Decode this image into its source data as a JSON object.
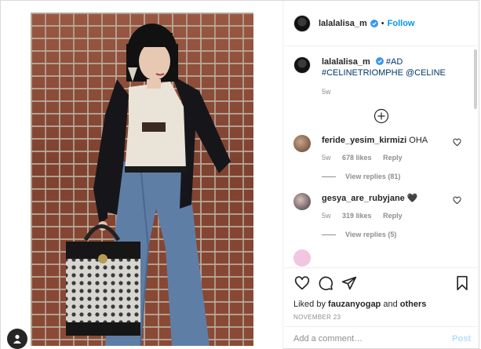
{
  "header": {
    "username": "lalalalisa_m",
    "separator": "•",
    "follow_label": "Follow"
  },
  "caption": {
    "username": "lalalalisa_m",
    "hashtag_line1": "#AD",
    "hashtag_line2": "#CELINETRIOMPHE",
    "mention": "@CELINE",
    "age": "5w"
  },
  "comments": [
    {
      "username": "feride_yesim_kirmizi",
      "text": "OHA",
      "age": "5w",
      "likes": "678 likes",
      "reply_label": "Reply",
      "view_replies": "View replies (81)",
      "avatar_color": "#7a5a4a"
    },
    {
      "username": "gesya_are_rubyjane",
      "text": "🖤",
      "age": "5w",
      "likes": "319 likes",
      "reply_label": "Reply",
      "view_replies": "View replies (5)",
      "avatar_color": "#6b6870"
    }
  ],
  "actions": {
    "liked_by_prefix": "Liked by",
    "liked_by_user": "fauzanyogap",
    "liked_by_and": "and",
    "liked_by_others": "others",
    "timestamp": "NOVEMBER 23"
  },
  "add_comment": {
    "placeholder": "Add a comment…",
    "post_label": "Post"
  },
  "colors": {
    "link_blue": "#0095f6",
    "hashtag": "#00376b",
    "muted": "#8e8e8e",
    "post_disabled": "#b2dffc"
  },
  "icons": [
    "verified-icon",
    "plus-circle-icon",
    "heart-icon",
    "comment-icon",
    "share-icon",
    "bookmark-icon",
    "user-tag-icon"
  ]
}
